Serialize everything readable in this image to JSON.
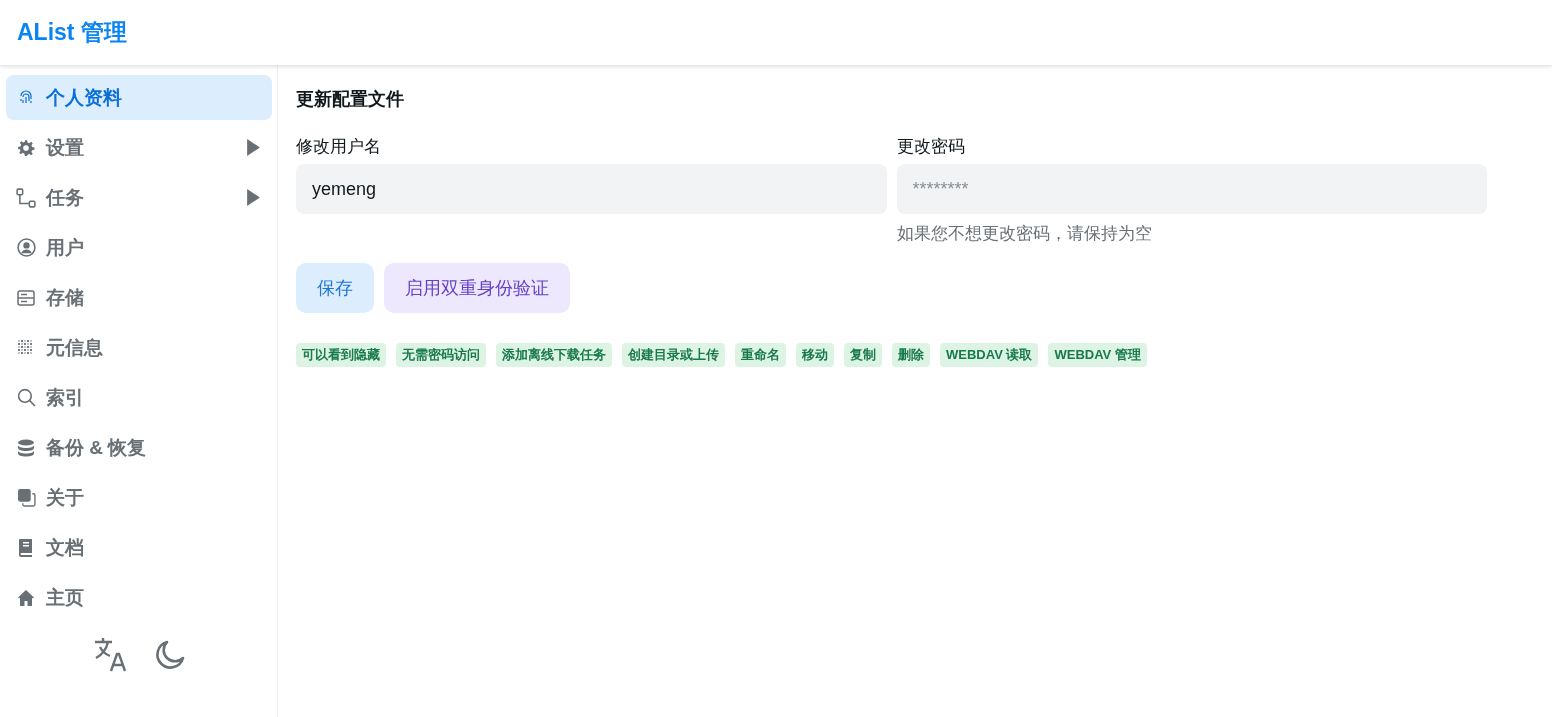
{
  "header": {
    "title": "AList 管理"
  },
  "sidebar": {
    "items": [
      {
        "kind": "fingerprint",
        "label": "个人资料",
        "selected": true,
        "submenu": false
      },
      {
        "kind": "gear",
        "label": "设置",
        "selected": false,
        "submenu": true
      },
      {
        "kind": "flow",
        "label": "任务",
        "selected": false,
        "submenu": true
      },
      {
        "kind": "user",
        "label": "用户",
        "selected": false,
        "submenu": false
      },
      {
        "kind": "storage",
        "label": "存储",
        "selected": false,
        "submenu": false
      },
      {
        "kind": "grid",
        "label": "元信息",
        "selected": false,
        "submenu": false
      },
      {
        "kind": "search",
        "label": "索引",
        "selected": false,
        "submenu": false
      },
      {
        "kind": "database",
        "label": "备份 & 恢复",
        "selected": false,
        "submenu": false
      },
      {
        "kind": "copy",
        "label": "关于",
        "selected": false,
        "submenu": false
      },
      {
        "kind": "book",
        "label": "文档",
        "selected": false,
        "submenu": false
      },
      {
        "kind": "home",
        "label": "主页",
        "selected": false,
        "submenu": false
      }
    ]
  },
  "main": {
    "title": "更新配置文件",
    "fields": [
      {
        "label": "修改用户名",
        "value": "yemeng"
      },
      {
        "label": "更改密码",
        "placeholder": "********",
        "hint": "如果您不想更改密码，请保持为空"
      }
    ],
    "buttons": [
      {
        "kind": "primary",
        "label": "保存"
      },
      {
        "kind": "secondary",
        "label": "启用双重身份验证"
      }
    ],
    "permissions": [
      "可以看到隐藏",
      "无需密码访问",
      "添加离线下载任务",
      "创建目录或上传",
      "重命名",
      "移动",
      "复制",
      "删除",
      "WEBDAV 读取",
      "WEBDAV 管理"
    ]
  }
}
